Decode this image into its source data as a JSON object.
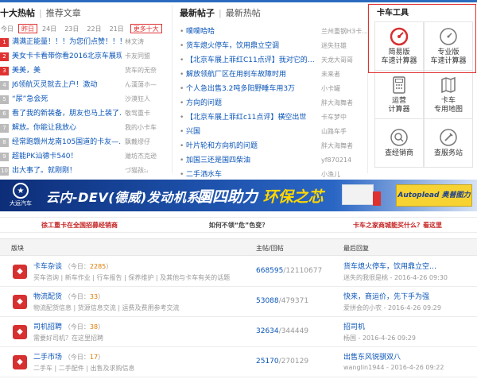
{
  "hot": {
    "title": "十大热帖",
    "alt": "推荐文章",
    "dates": [
      "今日",
      "昨日",
      "24日",
      "23日",
      "22日",
      "21日"
    ],
    "more": "更多十大",
    "items": [
      {
        "n": "1",
        "title": "满满正能量！！！为您们点赞！！！",
        "author": "林文涛"
      },
      {
        "n": "2",
        "title": "美女卡卡看带你看2016北京车展现…",
        "author": "卡友同盟"
      },
      {
        "n": "3",
        "title": "美美，美",
        "author": "货车的无奈"
      },
      {
        "n": "4",
        "title": "J6领航灭灵就去上户！激动",
        "author": "ん漢蕩ホ—"
      },
      {
        "n": "5",
        "title": "“尿”急会死",
        "author": "沙漠狂人"
      },
      {
        "n": "6",
        "title": "看了我的新装备，朋友也马上装了…",
        "author": "敬驾重卡"
      },
      {
        "n": "7",
        "title": "解放。你能让我放心",
        "author": "我的小卡车"
      },
      {
        "n": "8",
        "title": "经常跑赣州龙南105国道的卡友—…",
        "author": "飘戴缪仔"
      },
      {
        "n": "9",
        "title": "超能PK汕德卡540！",
        "author": "濰坊杰克逊"
      },
      {
        "n": "10",
        "title": "出大事了。就刚刚！",
        "author": "づ猫孩ಒ"
      }
    ]
  },
  "latest": {
    "title": "最新帖子",
    "alt": "最新热帖",
    "items": [
      {
        "title": "噗噗哈哈",
        "author": "兰州重钢H3卡…"
      },
      {
        "title": "货车熄火停车，饮用鼎立空调",
        "author": "迷失狂雄"
      },
      {
        "title": "【北京车展上菲红C11点评】我对它的…",
        "author": "天龙大哥哥"
      },
      {
        "title": "解放领航厂区在用刹车故障时用",
        "author": "未来者"
      },
      {
        "title": "个人急出售3.2吨多阳野睡车用3万",
        "author": "小卡罐"
      },
      {
        "title": "方向的问题",
        "author": "胖大海舞者"
      },
      {
        "title": "【北京车展上菲红c11点评】横空出世",
        "author": "卡车梦中"
      },
      {
        "title": "兴国",
        "author": "山路车手"
      },
      {
        "title": "叶片轮和方向机的问题",
        "author": "胖大海舞者"
      },
      {
        "title": "加国三还是国四柴油",
        "author": "yf870214"
      },
      {
        "title": "二手洒水车",
        "author": "小渔儿"
      }
    ]
  },
  "tools": {
    "title": "卡车工具",
    "items": [
      {
        "line1": "简易版",
        "line2": "车速计算器",
        "icon": "speedometer-red-icon"
      },
      {
        "line1": "专业版",
        "line2": "车速计算器",
        "icon": "speedometer-gray-icon"
      },
      {
        "line1": "运营",
        "line2": "计算器",
        "icon": "calculator-icon"
      },
      {
        "line1": "卡车",
        "line2": "专用地图",
        "icon": "map-icon"
      },
      {
        "line1": "查经销商",
        "line2": "",
        "icon": "search-icon"
      },
      {
        "line1": "查服务站",
        "line2": "",
        "icon": "service-icon"
      }
    ]
  },
  "banner": {
    "brand": "大运汽车",
    "tagline1": "云内-DEV(德威)发动机系列",
    "tagline2_a": "国四助力",
    "tagline2_b": "环保之芯",
    "partner": "Autoplead 奥普图力"
  },
  "ads": [
    "徐工重卡在全国招募经销商",
    "如何不领“危”色变？",
    "卡车之家商城能买什么？看这里"
  ],
  "table": {
    "col_block": "版块",
    "col_stat": "主帖/回帖",
    "col_last": "最后回复",
    "rows": [
      {
        "name": "卡车杂谈",
        "today_label": "（今日：",
        "today": "2285",
        "today_end": "）",
        "sub": "买车咨询 | 新车作业 | 行车报告 | 保养维护 | 及其他与卡车有关的话题",
        "posts": "668595",
        "replies": "12110677",
        "last": "货车熄火停车，饮用鼎立空…",
        "last_by": "迷失的我很是桃 - 2016-4-26 09:30"
      },
      {
        "name": "物流配货",
        "today_label": "（今日：",
        "today": "33",
        "today_end": "）",
        "sub": "物流配货信息 | 货源信息交流 | 运费及费用参考交流",
        "posts": "53088",
        "replies": "479371",
        "last": "快来，商运价，先下手为强",
        "last_by": "爱拼会的小农 - 2016-4-26 09:29"
      },
      {
        "name": "司机招聘",
        "today_label": "（今日：",
        "today": "38",
        "today_end": "）",
        "sub": "需要好司机？在这里招聘",
        "posts": "32634",
        "replies": "344449",
        "last": "招司机",
        "last_by": "杨国 - 2016-4-26 09:29"
      },
      {
        "name": "二手市场",
        "today_label": "（今日：",
        "today": "17",
        "today_end": "）",
        "sub": "二手车 | 二手配件 | 出售及求购信息",
        "posts": "25170",
        "replies": "270129",
        "last": "出售东风锐骐双八",
        "last_by": "wanglin1944 - 2016-4-26 09:22"
      }
    ]
  }
}
